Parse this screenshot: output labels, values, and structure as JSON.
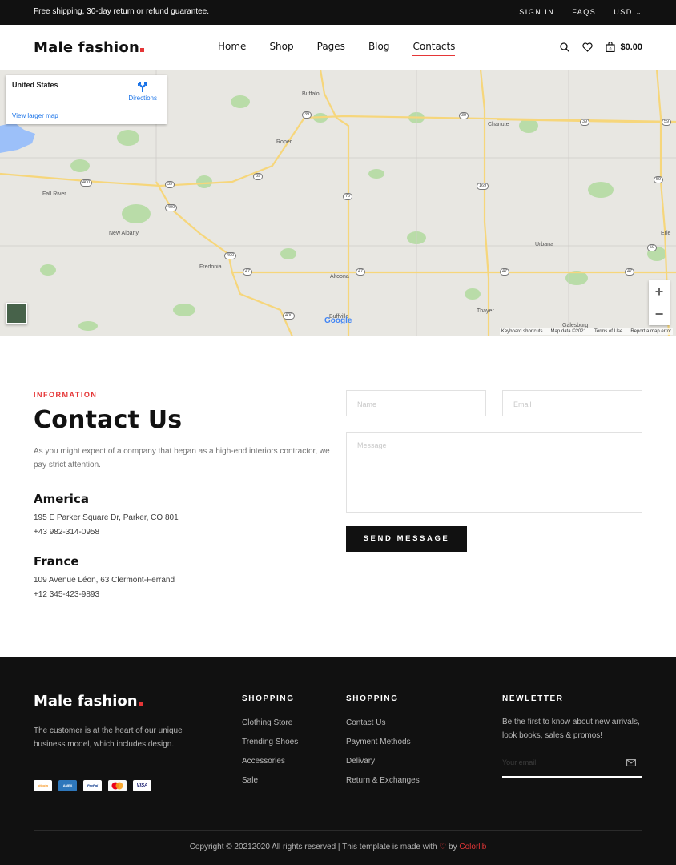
{
  "topbar": {
    "promo": "Free shipping, 30-day return or refund guarantee.",
    "sign_in": "SIGN IN",
    "faqs": "FAQS",
    "currency": "USD"
  },
  "header": {
    "logo": "Male fashion",
    "nav": [
      "Home",
      "Shop",
      "Pages",
      "Blog",
      "Contacts"
    ],
    "active_nav": "Contacts",
    "cart_total": "$0.00"
  },
  "map": {
    "place": "United States",
    "directions": "Directions",
    "view_larger": "View larger map",
    "zoom_in": "+",
    "zoom_out": "−",
    "google": "Google",
    "footer_links": [
      "Keyboard shortcuts",
      "Map data ©2021",
      "Terms of Use",
      "Report a map error"
    ],
    "towns": [
      "Buffalo",
      "Chanute",
      "Roper",
      "Fall River",
      "New Albany",
      "Fredonia",
      "Altoona",
      "Urbana",
      "Erie",
      "Thayer",
      "Buffville",
      "Galesburg"
    ],
    "routes": [
      "39",
      "39",
      "39",
      "59",
      "400",
      "39",
      "400",
      "75",
      "169",
      "59",
      "400",
      "47",
      "47",
      "47",
      "47",
      "59",
      "400",
      "39"
    ]
  },
  "contact": {
    "label": "INFORMATION",
    "title": "Contact Us",
    "description": "As you might expect of a company that began as a high-end interiors contractor, we pay strict attention.",
    "offices": [
      {
        "name": "America",
        "address": "195 E Parker Square Dr, Parker, CO 801",
        "phone": "+43 982-314-0958"
      },
      {
        "name": "France",
        "address": "109 Avenue Léon, 63 Clermont-Ferrand",
        "phone": "+12 345-423-9893"
      }
    ],
    "form": {
      "name_placeholder": "Name",
      "email_placeholder": "Email",
      "message_placeholder": "Message",
      "submit": "SEND MESSAGE"
    }
  },
  "footer": {
    "logo": "Male fashion",
    "description": "The customer is at the heart of our unique business model, which includes design.",
    "payment_methods": [
      "bitcoin",
      "AMEX",
      "PayPal",
      "MasterCard",
      "VISA"
    ],
    "columns": [
      {
        "heading": "SHOPPING",
        "items": [
          "Clothing Store",
          "Trending Shoes",
          "Accessories",
          "Sale"
        ]
      },
      {
        "heading": "SHOPPING",
        "items": [
          "Contact Us",
          "Payment Methods",
          "Delivary",
          "Return & Exchanges"
        ]
      }
    ],
    "newsletter": {
      "heading": "NEWLETTER",
      "text": "Be the first to know about new arrivals, look books, sales & promos!",
      "placeholder": "Your email"
    },
    "copyright_prefix": "Copyright © 20212020 All rights reserved | This template is made with",
    "copyright_by": "by",
    "copyright_brand": "Colorlib"
  },
  "colors": {
    "accent": "#e53637",
    "dark": "#111111",
    "muted": "#b7b7b7"
  }
}
